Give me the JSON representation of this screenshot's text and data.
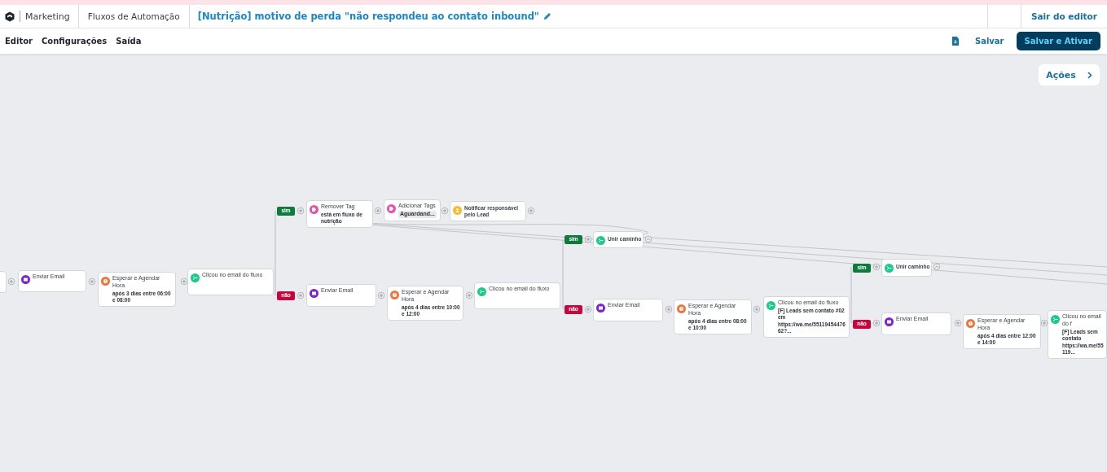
{
  "header": {
    "app": "Marketing",
    "section": "Fluxos de Automação",
    "title": "[Nutrição] motivo de perda \"não respondeu ao contato inbound\"",
    "exit": "Sair do editor"
  },
  "tabs": [
    {
      "label": "Editor"
    },
    {
      "label": "Configurações"
    },
    {
      "label": "Saída"
    }
  ],
  "toolbar": {
    "save": "Salvar",
    "save_activate": "Salvar e Ativar"
  },
  "actions_button": "Ações",
  "nodes": [
    {
      "kind": "partial"
    },
    {
      "kind": "email",
      "title": "Enviar Email"
    },
    {
      "kind": "wait",
      "title": "Esperar e Agendar Hora",
      "subtitle": "após 3 dias entre 06:00 e 08:00"
    },
    {
      "kind": "condition",
      "title": "Clicou no email do fluxo"
    },
    {
      "kind": "branch",
      "color": "#0f7a3c",
      "label": "sim"
    },
    {
      "kind": "tag",
      "title": "Remover Tag",
      "subtitle": "está em fluxo de nutrição"
    },
    {
      "kind": "tag",
      "title": "Adicionar Tags",
      "chip": "Aguardand..."
    },
    {
      "kind": "notify",
      "title": "Notificar responsável pelo Lead"
    },
    {
      "kind": "branch",
      "color": "#c8063e",
      "label": "não"
    },
    {
      "kind": "email",
      "title": "Enviar Email"
    },
    {
      "kind": "wait",
      "title": "Esperar e Agendar Hora",
      "subtitle": "após 4 dias entre 10:00 e 12:00"
    },
    {
      "kind": "condition",
      "title": "Clicou no email do fluxo"
    },
    {
      "kind": "branch",
      "color": "#0f7a3c",
      "label": "sim"
    },
    {
      "kind": "merge",
      "title": "Unir caminho"
    },
    {
      "kind": "branch",
      "color": "#c8063e",
      "label": "não"
    },
    {
      "kind": "email",
      "title": "Enviar Email"
    },
    {
      "kind": "wait",
      "title": "Esperar e Agendar Hora",
      "subtitle": "após 4 dias entre 08:00 e 10:00"
    },
    {
      "kind": "condition",
      "title": "Clicou no email do fluxo",
      "subtitle": "[F] Leads sem contato #02 em",
      "detail": "https://wa.me/5511945447662?..."
    },
    {
      "kind": "branch",
      "color": "#0f7a3c",
      "label": "sim"
    },
    {
      "kind": "merge",
      "title": "Unir caminho"
    },
    {
      "kind": "branch",
      "color": "#c8063e",
      "label": "não"
    },
    {
      "kind": "email",
      "title": "Enviar Email"
    },
    {
      "kind": "wait",
      "title": "Esperar e Agendar Hora",
      "subtitle": "após 4 dias entre 12:00 e 14:00"
    },
    {
      "kind": "condition",
      "title": "Clicou no email do f",
      "subtitle": "[F] Leads sem contato",
      "detail": "https://wa.me/55119..."
    }
  ]
}
